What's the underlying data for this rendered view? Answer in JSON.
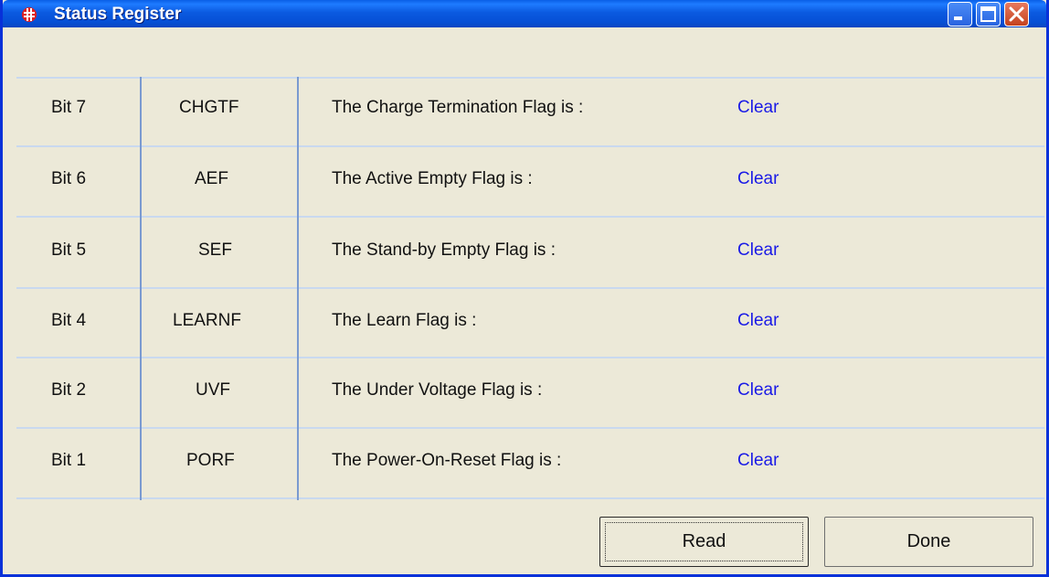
{
  "window": {
    "title": "Status Register"
  },
  "rows": [
    {
      "bit": "Bit 7",
      "name": "CHGTF",
      "description": "The Charge Termination Flag is :",
      "status": "Clear"
    },
    {
      "bit": "Bit 6",
      "name": "AEF",
      "description": "The Active Empty Flag  is :",
      "status": "Clear"
    },
    {
      "bit": "Bit 5",
      "name": "SEF",
      "description": "The Stand-by Empty Flag  is :",
      "status": "Clear"
    },
    {
      "bit": "Bit 4",
      "name": "LEARNF",
      "description": "The Learn Flag is :",
      "status": "Clear"
    },
    {
      "bit": "Bit 2",
      "name": "UVF",
      "description": "The Under Voltage Flag is :",
      "status": "Clear"
    },
    {
      "bit": "Bit 1",
      "name": "PORF",
      "description": "The Power-On-Reset Flag is :",
      "status": "Clear"
    }
  ],
  "buttons": {
    "read": "Read",
    "done": "Done"
  },
  "icons": {
    "app": "register-app-icon",
    "minimize": "minimize-icon",
    "maximize": "maximize-icon",
    "close": "close-icon"
  },
  "colors": {
    "status_text": "#1a1ae6",
    "titlebar": "#0a5fe6",
    "window_bg": "#ece9d8"
  }
}
